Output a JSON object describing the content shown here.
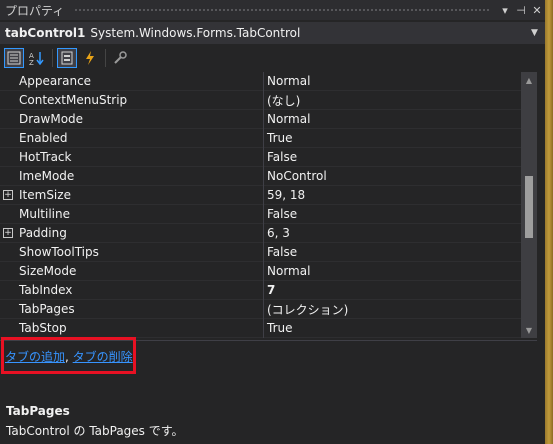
{
  "window": {
    "title": "プロパティ",
    "controls": [
      "▾",
      "⊣",
      "✕"
    ]
  },
  "object_selector": {
    "name": "tabControl1",
    "type": "System.Windows.Forms.TabControl"
  },
  "properties": [
    {
      "name": "Appearance",
      "value": "Normal",
      "expandable": false,
      "bold": false
    },
    {
      "name": "ContextMenuStrip",
      "value": "(なし)",
      "expandable": false,
      "bold": false
    },
    {
      "name": "DrawMode",
      "value": "Normal",
      "expandable": false,
      "bold": false
    },
    {
      "name": "Enabled",
      "value": "True",
      "expandable": false,
      "bold": false
    },
    {
      "name": "HotTrack",
      "value": "False",
      "expandable": false,
      "bold": false
    },
    {
      "name": "ImeMode",
      "value": "NoControl",
      "expandable": false,
      "bold": false
    },
    {
      "name": "ItemSize",
      "value": "59, 18",
      "expandable": true,
      "bold": false
    },
    {
      "name": "Multiline",
      "value": "False",
      "expandable": false,
      "bold": false
    },
    {
      "name": "Padding",
      "value": "6, 3",
      "expandable": true,
      "bold": false
    },
    {
      "name": "ShowToolTips",
      "value": "False",
      "expandable": false,
      "bold": false
    },
    {
      "name": "SizeMode",
      "value": "Normal",
      "expandable": false,
      "bold": false
    },
    {
      "name": "TabIndex",
      "value": "7",
      "expandable": false,
      "bold": true
    },
    {
      "name": "TabPages",
      "value": "(コレクション)",
      "expandable": false,
      "bold": false
    },
    {
      "name": "TabStop",
      "value": "True",
      "expandable": false,
      "bold": false
    }
  ],
  "commands": {
    "add_tab": "タブの追加",
    "separator": ", ",
    "remove_tab": "タブの削除"
  },
  "description": {
    "title": "TabPages",
    "text": "TabControl の TabPages です。"
  },
  "colors": {
    "background": "#252526",
    "link": "#3794ff",
    "highlight_box": "#e81123",
    "active_tool_border": "#3399ff"
  }
}
